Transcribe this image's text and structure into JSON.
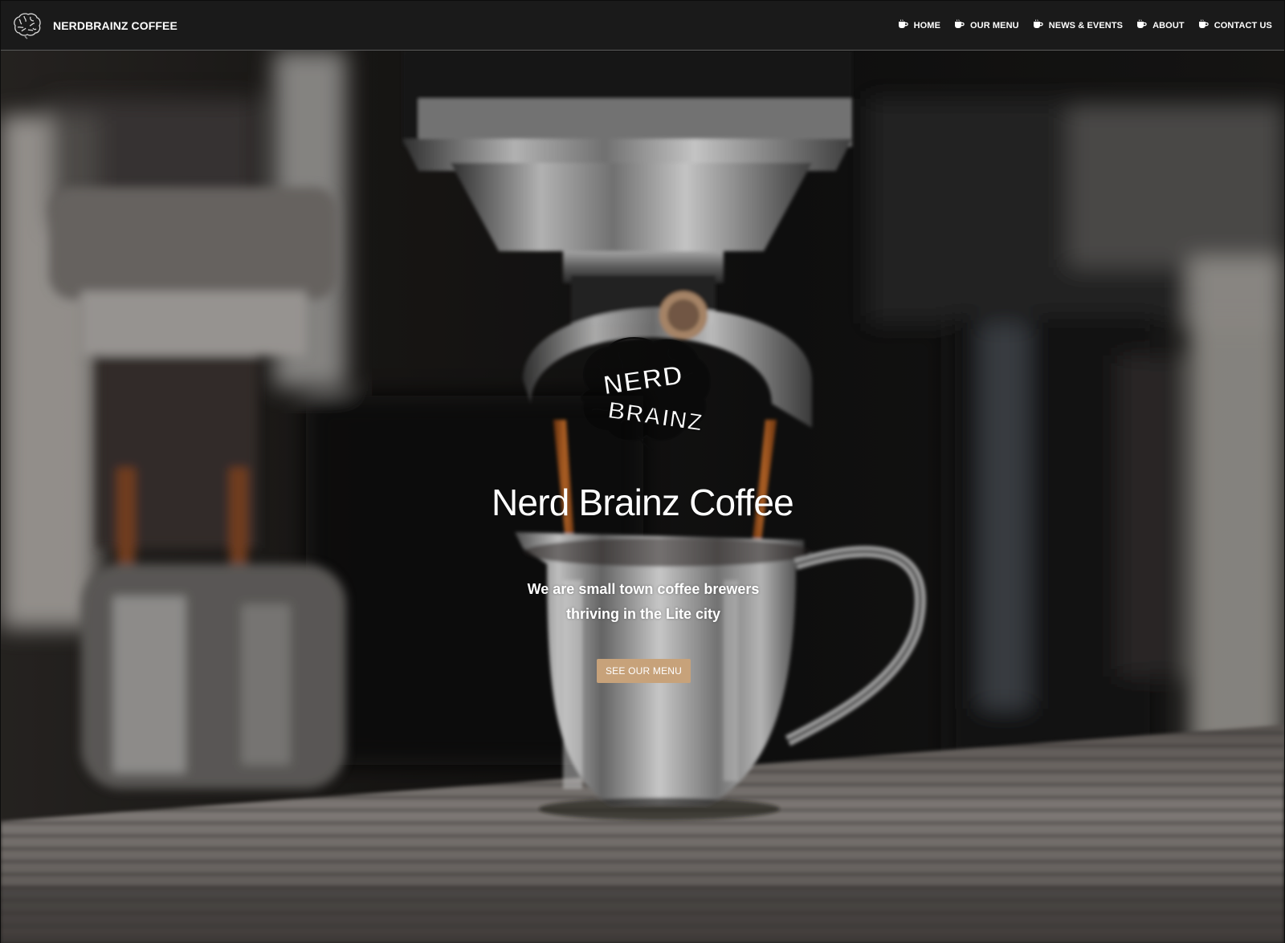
{
  "navbar": {
    "brand_name": "NERDBRAINZ COFFEE",
    "brand_logo_icon": "brain-logo-icon",
    "items": [
      {
        "label": "HOME",
        "icon": "coffee-cup-icon"
      },
      {
        "label": "OUR MENU",
        "icon": "coffee-cup-icon"
      },
      {
        "label": "NEWS & EVENTS",
        "icon": "coffee-cup-icon"
      },
      {
        "label": "ABOUT",
        "icon": "coffee-cup-icon"
      },
      {
        "label": "CONTACT US",
        "icon": "coffee-cup-icon"
      }
    ]
  },
  "hero": {
    "background": "espresso-machine-photo",
    "logo_icon": "nerd-brainz-brain-logo",
    "logo_text": "NERD BRAINZ",
    "title": "Nerd Brainz Coffee",
    "tagline_line1": "We are small town coffee brewers",
    "tagline_line2": "thriving in the Lite city",
    "cta_label": "SEE OUR MENU"
  },
  "colors": {
    "navbar_bg": "#1a1a1a",
    "cta_bg": "#c7a27a",
    "text": "#ffffff"
  }
}
